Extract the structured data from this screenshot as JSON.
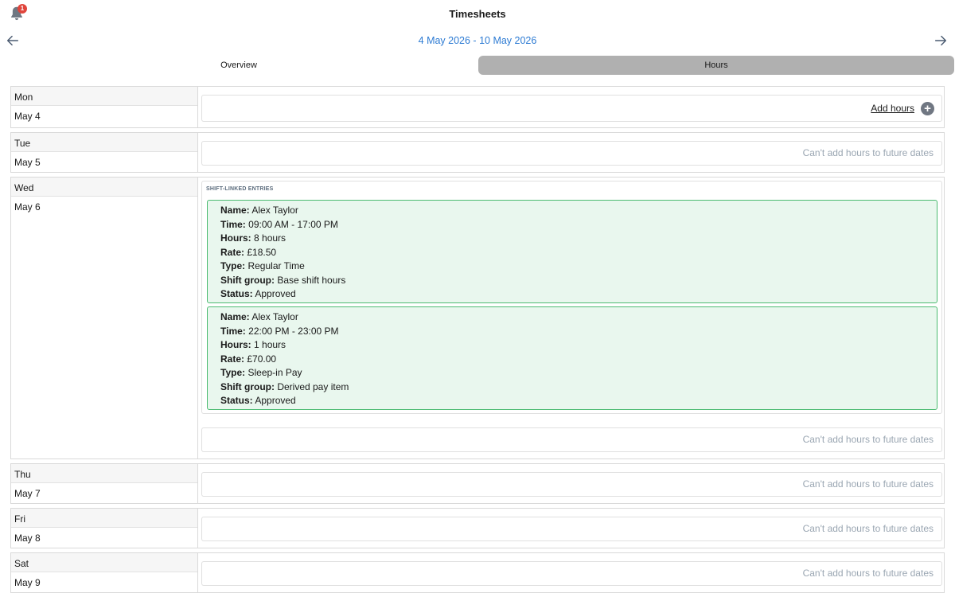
{
  "header": {
    "title": "Timesheets",
    "notification_count": "1"
  },
  "week": {
    "range": "4 May 2026 - 10 May 2026"
  },
  "tabs": [
    {
      "label": "Overview",
      "active": false
    },
    {
      "label": "Hours",
      "active": true
    }
  ],
  "messages": {
    "add_hours": "Add hours",
    "future": "Can't add hours to future dates",
    "shift_linked_heading": "SHIFT-LINKED ENTRIES"
  },
  "field_labels": {
    "name": "Name:",
    "time": "Time:",
    "hours": "Hours:",
    "rate": "Rate:",
    "type": "Type:",
    "shift_group": "Shift group:",
    "status": "Status:"
  },
  "days": [
    {
      "name": "Mon",
      "date": "May 4"
    },
    {
      "name": "Tue",
      "date": "May 5"
    },
    {
      "name": "Wed",
      "date": "May 6"
    },
    {
      "name": "Thu",
      "date": "May 7"
    },
    {
      "name": "Fri",
      "date": "May 8"
    },
    {
      "name": "Sat",
      "date": "May 9"
    }
  ],
  "entries": [
    {
      "name": "Alex Taylor",
      "time": "09:00 AM - 17:00 PM",
      "hours": "8 hours",
      "rate": "£18.50",
      "type": "Regular Time",
      "shift_group": "Base shift hours",
      "status": "Approved"
    },
    {
      "name": "Alex Taylor",
      "time": "22:00 PM - 23:00 PM",
      "hours": "1 hours",
      "rate": "£70.00",
      "type": "Sleep-in Pay",
      "shift_group": "Derived pay item",
      "status": "Approved"
    }
  ],
  "colors": {
    "accent": "#2d7bd3",
    "badge": "#e0453c",
    "entry_bg": "#e9f7ee",
    "entry_border": "#4cbb71",
    "muted_text": "#9aa6b2",
    "active_tab": "#b0b0b0"
  },
  "icons": {
    "notifications": "bell-icon",
    "previous_week": "arrow-left-icon",
    "next_week": "arrow-right-icon",
    "add": "plus-circle-icon"
  }
}
